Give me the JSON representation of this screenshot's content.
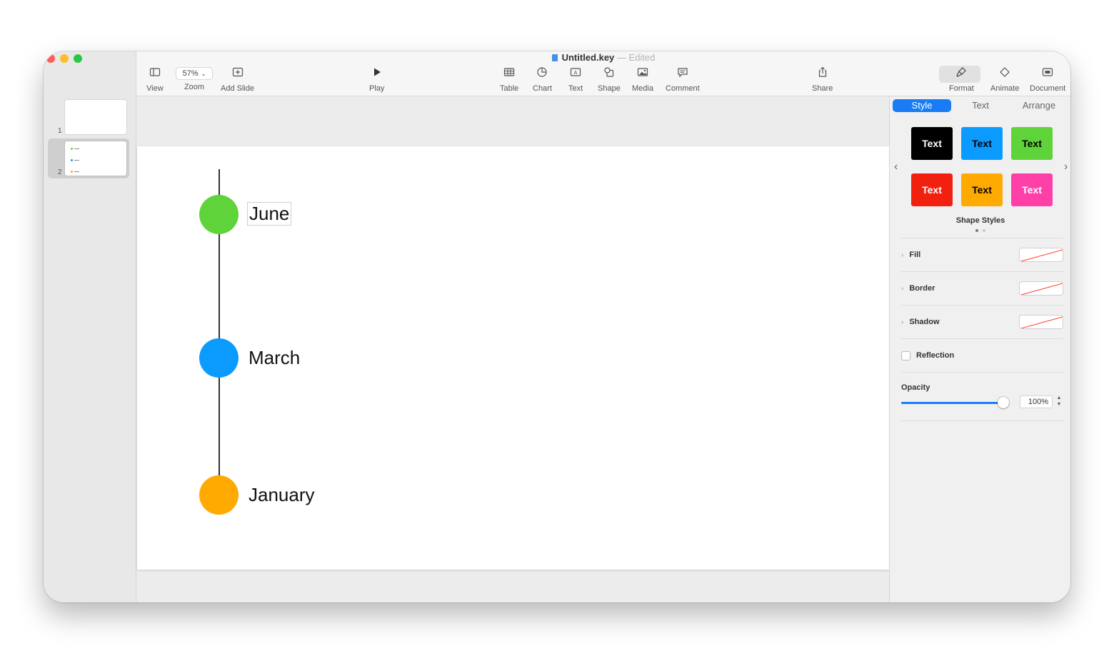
{
  "window": {
    "title": "Untitled.key",
    "separator": "—",
    "status": "Edited"
  },
  "navigator": {
    "slides": [
      {
        "number": "1"
      },
      {
        "number": "2",
        "bullets": [
          "#5fd43a",
          "#0b9bff",
          "#ffaa00"
        ]
      }
    ]
  },
  "toolbar": {
    "view": "View",
    "zoom_value": "57%",
    "zoom": "Zoom",
    "add_slide": "Add Slide",
    "play": "Play",
    "table": "Table",
    "chart": "Chart",
    "text": "Text",
    "shape": "Shape",
    "media": "Media",
    "comment": "Comment",
    "share": "Share",
    "format": "Format",
    "animate": "Animate",
    "document": "Document"
  },
  "slide": {
    "items": [
      {
        "label": "June",
        "color": "#5fd43a"
      },
      {
        "label": "March",
        "color": "#0b9bff"
      },
      {
        "label": "January",
        "color": "#ffaa00"
      }
    ]
  },
  "inspector": {
    "tabs": [
      "Style",
      "Text",
      "Arrange"
    ],
    "swatches": [
      {
        "label": "Text",
        "bg": "#000000",
        "fg": "#ffffff"
      },
      {
        "label": "Text",
        "bg": "#0b9bff",
        "fg": "#000000"
      },
      {
        "label": "Text",
        "bg": "#5fd43a",
        "fg": "#000000"
      },
      {
        "label": "Text",
        "bg": "#f2210f",
        "fg": "#ffffff"
      },
      {
        "label": "Text",
        "bg": "#ffaa00",
        "fg": "#000000"
      },
      {
        "label": "Text",
        "bg": "#ff3fa8",
        "fg": "#ffffff"
      }
    ],
    "shape_styles": "Shape Styles",
    "fill": "Fill",
    "border": "Border",
    "shadow": "Shadow",
    "reflection": "Reflection",
    "opacity_label": "Opacity",
    "opacity_value": "100%",
    "accent": "#1a7cf5"
  }
}
